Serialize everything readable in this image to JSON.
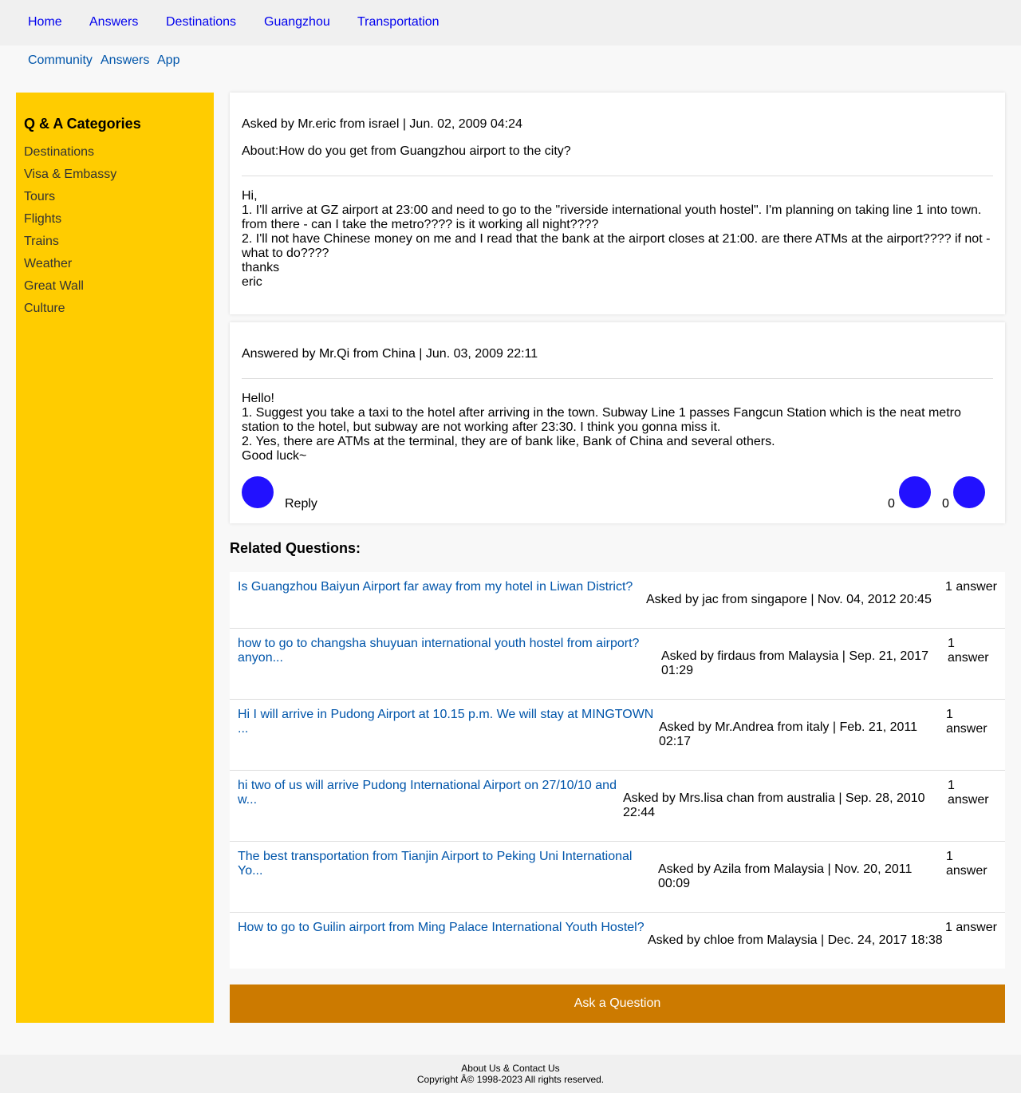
{
  "topnav": {
    "items": [
      "Home",
      "Answers",
      "Destinations",
      "Guangzhou",
      "Transportation"
    ]
  },
  "subnav": {
    "items": [
      "Community",
      "Answers",
      "App"
    ]
  },
  "sidebar": {
    "title": "Q & A Categories",
    "items": [
      "Destinations",
      "Visa & Embassy",
      "Tours",
      "Flights",
      "Trains",
      "Weather",
      "Great Wall",
      "Culture"
    ]
  },
  "question": {
    "meta": "Asked by Mr.eric from israel | Jun. 02, 2009 04:24",
    "about": "About:How do you get from Guangzhou airport to the city?",
    "lines": [
      "Hi,",
      "1. I'll arrive at GZ airport at 23:00 and need to go to the \"riverside international youth hostel\". I'm planning on taking line 1 into town. from there - can I take the metro???? is it working all night????",
      "2. I'll not have Chinese money on me and I read that the bank at the airport closes at 21:00. are there ATMs at the airport???? if not - what to do????",
      "thanks",
      "eric"
    ]
  },
  "answer": {
    "meta": "Answered by Mr.Qi from China | Jun. 03, 2009 22:11",
    "lines": [
      "Hello!",
      "1. Suggest you take a taxi to the hotel after arriving in the town. Subway Line 1 passes Fangcun Station which is the neat metro station to the hotel, but subway are not working after 23:30. I think you gonna miss it.",
      "2. Yes, there are ATMs at the terminal, they are of bank like, Bank of China and several others.",
      "Good luck~"
    ],
    "reply_label": "Reply",
    "upvotes": "0",
    "downvotes": "0",
    "accent_color": "#2211ff"
  },
  "related": {
    "title": "Related Questions:",
    "items": [
      {
        "title": "Is Guangzhou Baiyun Airport far away from my hotel in Liwan District?",
        "asked": "Asked by jac from singapore | Nov. 04, 2012 20:45",
        "answers": "1 answer"
      },
      {
        "title": "how to go to changsha shuyuan international youth hostel from airport? anyon...",
        "asked": "Asked by firdaus from Malaysia | Sep. 21, 2017 01:29",
        "answers": "1 answer"
      },
      {
        "title": "Hi I will arrive in Pudong Airport at 10.15 p.m. We will stay at MINGTOWN ...",
        "asked": "Asked by Mr.Andrea from italy | Feb. 21, 2011 02:17",
        "answers": "1 answer"
      },
      {
        "title": "hi two of us will arrive Pudong International Airport on 27/10/10 and w...",
        "asked": "Asked by Mrs.lisa chan from australia | Sep. 28, 2010 22:44",
        "answers": "1 answer"
      },
      {
        "title": "The best transportation from Tianjin Airport to Peking Uni International Yo...",
        "asked": "Asked by Azila from Malaysia | Nov. 20, 2011 00:09",
        "answers": "1 answer"
      },
      {
        "title": "How to go to Guilin airport from Ming Palace International Youth Hostel?",
        "asked": "Asked by chloe from Malaysia | Dec. 24, 2017 18:38",
        "answers": "1 answer"
      }
    ]
  },
  "ask_button": "Ask a Question",
  "footer": {
    "links": "About Us & Contact Us",
    "copyright": "Copyright Â© 1998-2023 All rights reserved."
  },
  "colors": {
    "sidebar_bg": "#ffcc00",
    "ask_button_bg": "#cc7a00",
    "link": "#0055aa",
    "nav_link": "#0000ee"
  }
}
